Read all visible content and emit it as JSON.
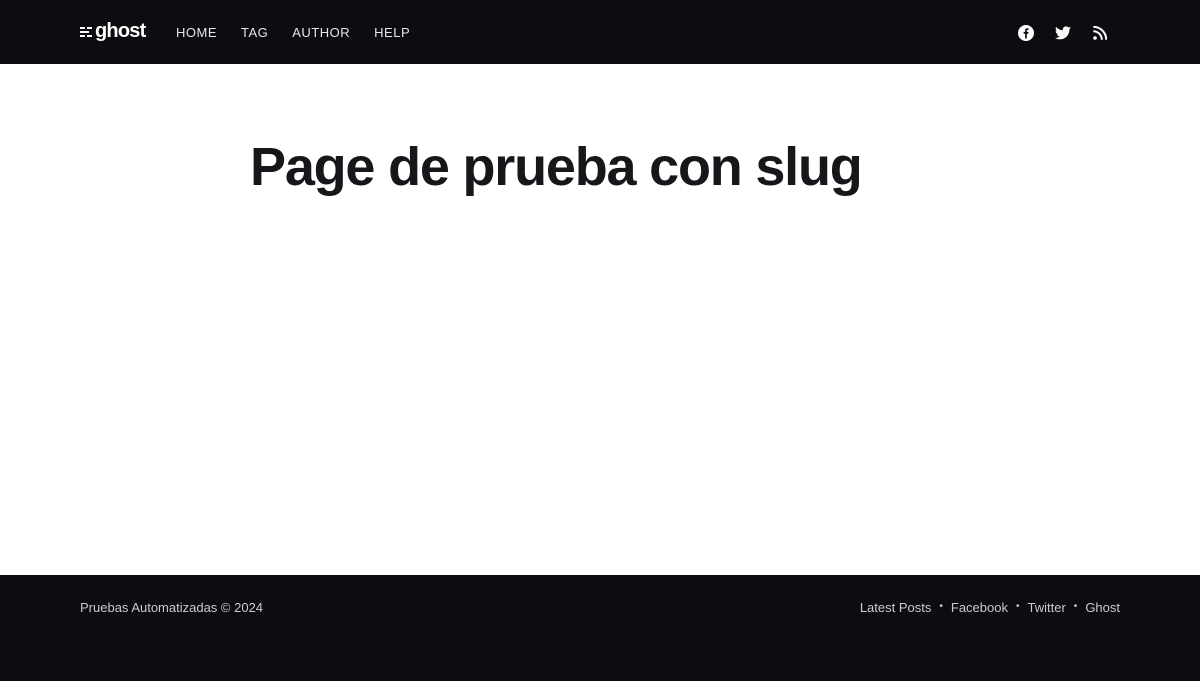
{
  "header": {
    "logo_text": "ghost",
    "nav": [
      {
        "label": "HOME"
      },
      {
        "label": "TAG"
      },
      {
        "label": "AUTHOR"
      },
      {
        "label": "HELP"
      }
    ],
    "social": [
      {
        "icon": "facebook-icon"
      },
      {
        "icon": "twitter-icon"
      },
      {
        "icon": "rss-icon"
      }
    ]
  },
  "main": {
    "title": "Page de prueba con slug"
  },
  "footer": {
    "copyright": "Pruebas Automatizadas © 2024",
    "links": [
      {
        "label": "Latest Posts"
      },
      {
        "label": "Facebook"
      },
      {
        "label": "Twitter"
      },
      {
        "label": "Ghost"
      }
    ],
    "separator": "•"
  },
  "colors": {
    "header_bg": "#0c0d10",
    "footer_bg": "#0c0d10",
    "title": "#15171a",
    "page_bg": "#ffffff"
  }
}
